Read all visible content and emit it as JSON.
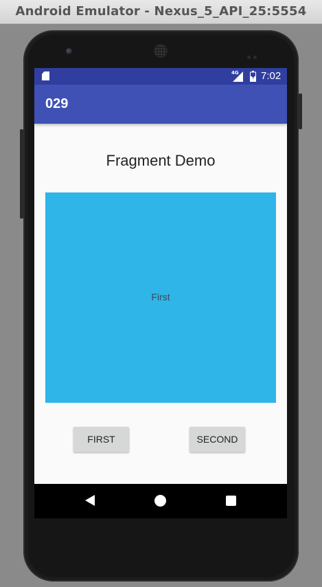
{
  "window": {
    "title": "Android Emulator - Nexus_5_API_25:5554"
  },
  "status_bar": {
    "network_label": "4G",
    "time": "7:02",
    "icons": [
      "sd-card-icon",
      "signal-icon",
      "battery-icon"
    ],
    "color": "#303f9f"
  },
  "app_bar": {
    "title": "029",
    "color": "#3f51b5"
  },
  "main": {
    "heading": "Fragment Demo",
    "fragment": {
      "label": "First",
      "color": "#2fb5e8"
    },
    "buttons": {
      "first_label": "FIRST",
      "second_label": "SECOND"
    }
  },
  "nav_bar": {
    "icons": [
      "back-icon",
      "home-icon",
      "recents-icon"
    ]
  }
}
